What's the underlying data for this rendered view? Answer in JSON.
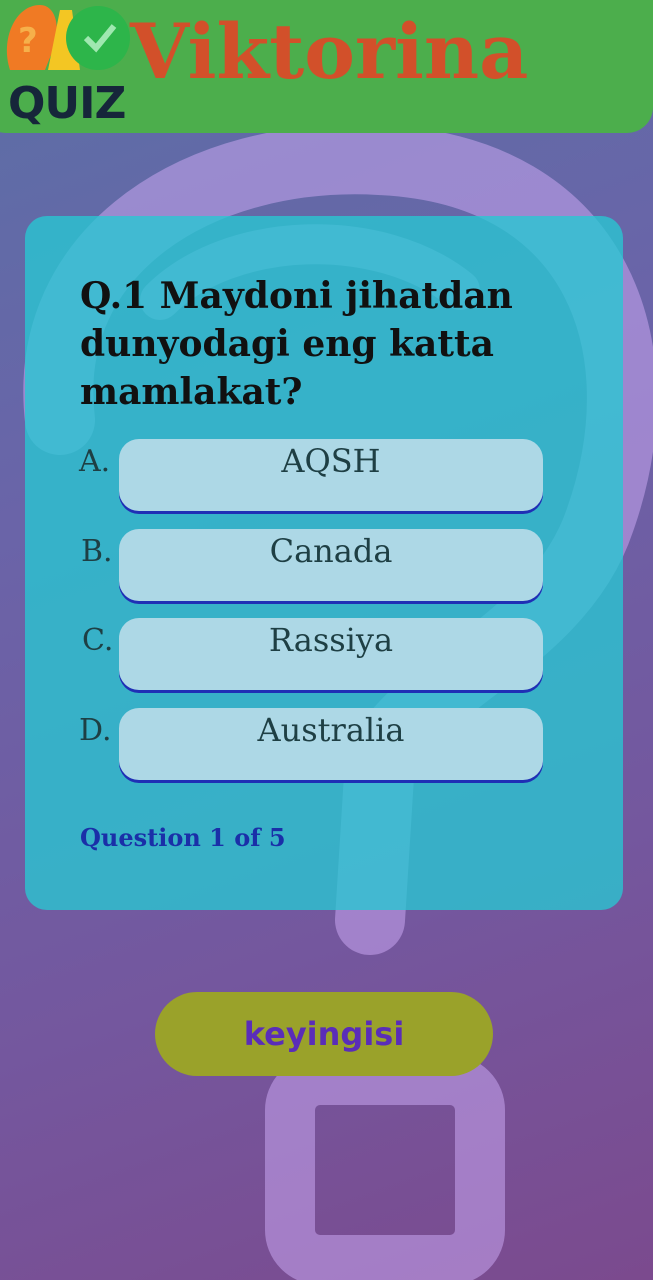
{
  "header": {
    "title": "Viktorina",
    "logo_text": "QUIZ",
    "logo_icon": "quiz-logo-icon",
    "colors": {
      "bar": "#4cae4c",
      "title": "#d2502a"
    }
  },
  "quiz": {
    "question": "Q.1 Maydoni jihatdan dunyodagi eng katta mamlakat?",
    "options": [
      {
        "letter": "A.",
        "label": "AQSH"
      },
      {
        "letter": "B.",
        "label": "Canada"
      },
      {
        "letter": "C.",
        "label": "Rassiya"
      },
      {
        "letter": "D.",
        "label": "Australia"
      }
    ],
    "progress": "Question 1 of 5"
  },
  "next_button": {
    "label": "keyingisi",
    "color": "#9aa22a"
  }
}
